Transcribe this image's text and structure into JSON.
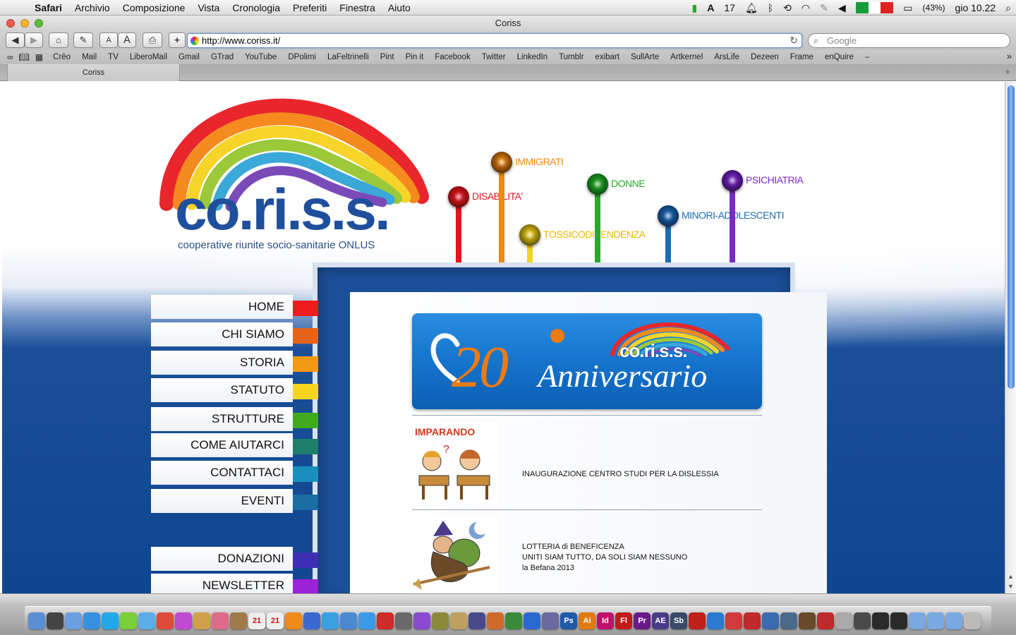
{
  "menubar": {
    "app": "Safari",
    "items": [
      "Archivio",
      "Composizione",
      "Vista",
      "Cronologia",
      "Preferiti",
      "Finestra",
      "Aiuto"
    ],
    "status": {
      "calendar_badge": "17",
      "battery": "(43%)",
      "clock": "gio 10.22"
    }
  },
  "window": {
    "title": "Coriss"
  },
  "toolbar": {
    "url": "http://www.coriss.it/",
    "search_placeholder": "Google",
    "font_small": "A",
    "font_large": "A",
    "add": "+"
  },
  "bookmarks": [
    "Crēo",
    "Mail",
    "TV",
    "LiberoMail",
    "Gmail",
    "GTrad",
    "YouTube",
    "DPolimi",
    "LaFeltrinelli",
    "Pint",
    "Pin it",
    "Facebook",
    "Twitter",
    "LinkedIn",
    "Tumblr",
    "exibart",
    "SullArte",
    "Artkernel",
    "ArsLife",
    "Dezeen",
    "Frame",
    "enQuire",
    "–"
  ],
  "tab": {
    "title": "Coriss"
  },
  "logo": {
    "word": "co.ri.s.s.",
    "tagline": "cooperative riunite socio-sanitarie ONLUS"
  },
  "categories": [
    {
      "label": "DISABILITA'",
      "color": "#e8121e",
      "ball": "#9a0e14"
    },
    {
      "label": "IMMIGRATI",
      "color": "#ef8a0f",
      "ball": "#8a4a05"
    },
    {
      "label": "TOSSICODIPENDENZA",
      "color": "#f5d21e",
      "ball": "#8c7a08"
    },
    {
      "label": "DONNE",
      "color": "#2aa82a",
      "ball": "#0f6e14"
    },
    {
      "label": "MINORI-ADOLESCENTI",
      "color": "#1d6db2",
      "ball": "#0f3f78"
    },
    {
      "label": "PSICHIATRIA",
      "color": "#7a2bc4",
      "ball": "#4a127e"
    }
  ],
  "nav": [
    {
      "label": "HOME",
      "color": "#ee1c1c"
    },
    {
      "label": "CHI SIAMO",
      "color": "#e6631b"
    },
    {
      "label": "STORIA",
      "color": "#f29a12"
    },
    {
      "label": "STATUTO",
      "color": "#f7d51f"
    },
    {
      "label": "STRUTTURE",
      "color": "#3faa1f"
    },
    {
      "label": "COME AIUTARCI",
      "color": "#1d7f6b"
    },
    {
      "label": "CONTATTACI",
      "color": "#1a8fbd"
    },
    {
      "label": "EVENTI",
      "color": "#1a6ea3"
    },
    {
      "label": "DONAZIONI",
      "color": "#3c2fb3"
    },
    {
      "label": "NEWSLETTER",
      "color": "#9b22d6"
    }
  ],
  "banner": {
    "number": "20",
    "text": "Anniversario",
    "brand": "co.ri.s.s."
  },
  "news": [
    {
      "thumb_title": "IMPARANDO",
      "lines": [
        "INAUGURAZIONE CENTRO STUDI PER LA DISLESSIA"
      ]
    },
    {
      "thumb_title": "",
      "lines": [
        "LOTTERIA di BENEFICENZA",
        "UNITI SIAM TUTTO, DA SOLI SIAM NESSUNO",
        "la Befana 2013"
      ]
    }
  ],
  "dock": {
    "icons": [
      "finder-icon",
      "dashboard-icon",
      "preview-icon",
      "safari-icon",
      "skype-icon",
      "app-icon",
      "messages-icon",
      "chrome-icon",
      "app-icon",
      "app-icon",
      "app-icon",
      "app-icon",
      "calendar-icon",
      "ical-icon",
      "vlc-icon",
      "app-icon",
      "itunes-icon",
      "app-icon",
      "download-icon",
      "app-icon",
      "app-icon",
      "app-icon",
      "app-icon",
      "app-icon",
      "app-icon",
      "app-icon",
      "app-icon",
      "app-icon",
      "app-icon",
      "photoshop-icon",
      "illustrator-icon",
      "indesign-icon",
      "flash-icon",
      "premiere-icon",
      "aftereffects-icon",
      "soundbooth-icon",
      "acrobat-icon",
      "app-icon",
      "app-icon",
      "app-icon",
      "app-icon",
      "app-icon",
      "app-icon",
      "app-icon",
      "app-icon",
      "app-icon",
      "app-icon",
      "app-icon",
      "folder-icon",
      "folder-icon",
      "folder-icon",
      "trash-icon"
    ],
    "labels": {
      "photoshop-icon": "Ps",
      "illustrator-icon": "Ai",
      "indesign-icon": "Id",
      "flash-icon": "Fl",
      "premiere-icon": "Pr",
      "aftereffects-icon": "AE",
      "soundbooth-icon": "Sb",
      "calendar-icon": "21",
      "ical-icon": "21"
    }
  }
}
